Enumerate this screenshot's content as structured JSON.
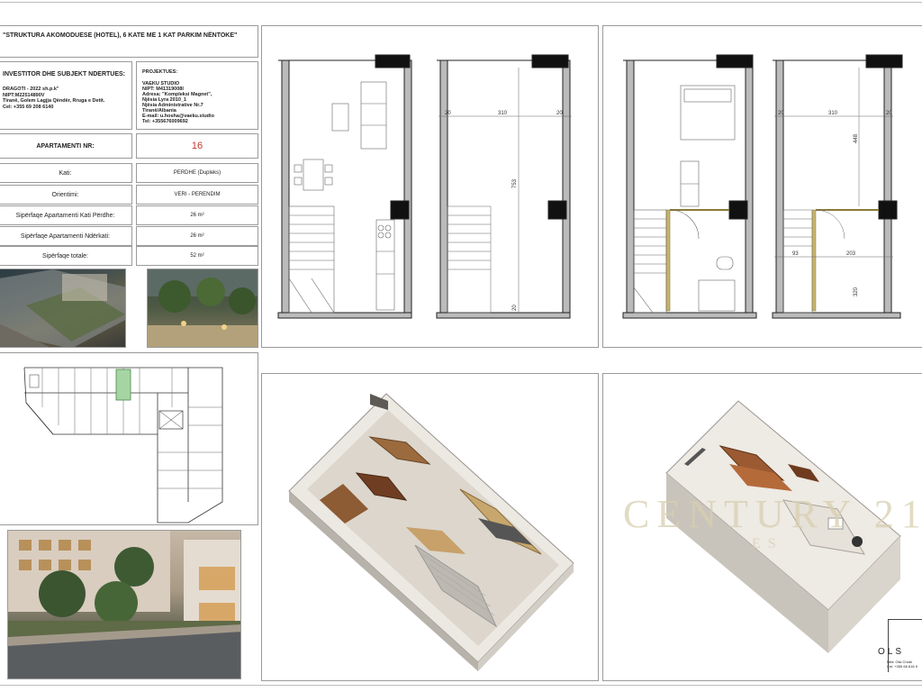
{
  "project": {
    "title": "\"STRUKTURA AKOMODUESE (HOTEL), 6 KATE ME 1 KAT PARKIM NËNTOKE\""
  },
  "investor": {
    "heading": "INVESTITOR DHE SUBJEKT NDERTUES:",
    "lines": [
      "DRAGOTI - 2022 sh.p.k\"",
      "NIPT:M22514890V",
      "Tiranë, Golem Lagjja Qëndër, Rruga e Detit.",
      "Cel: +355 69 208 6140"
    ]
  },
  "designer": {
    "heading": "PROJEKTUES:",
    "lines": [
      "VAEKU STUDIO",
      "NIPT: M41319008I",
      "Adresa: \"Kompleksi Magnet\",",
      "Njësia Lyra 2010_1",
      "Njësia Administrative Nr.7",
      "Tiranë/Albania",
      "E-mail: u.hosha@vaeku.studio",
      "Tel: +355676009692"
    ]
  },
  "apartment": {
    "label": "APARTAMENTI NR:",
    "number": "16",
    "number_color": "#c0392b"
  },
  "specs": [
    {
      "label": "Kati:",
      "value": "PERDHE (Dupleks)"
    },
    {
      "label": "Orientimi:",
      "value": "VERI - PERENDIM"
    },
    {
      "label": "Sipërfaqe Apartamenti Kati Përdhe:",
      "value": "26 m²"
    },
    {
      "label": "Sipërfaqe Apartamenti Ndërkati:",
      "value": "26 m²"
    },
    {
      "label": "Sipërfaqe totale:",
      "value": "52 m²"
    }
  ],
  "plans": {
    "ground": {
      "d1": "20",
      "d2": "310",
      "d3": "20",
      "d4": "753",
      "d5": "20"
    },
    "upper": {
      "d1": "20",
      "d2": "310",
      "d3": "20",
      "d4": "448",
      "d5": "93",
      "d6": "203",
      "d7": "320"
    }
  },
  "watermark": {
    "brand": "CENTURY 21",
    "sub": "ES"
  },
  "signature": {
    "logo": "OLS",
    "lines": [
      "Nëd: Olsi Chobi",
      "Cel: +355 66 616 9"
    ]
  }
}
